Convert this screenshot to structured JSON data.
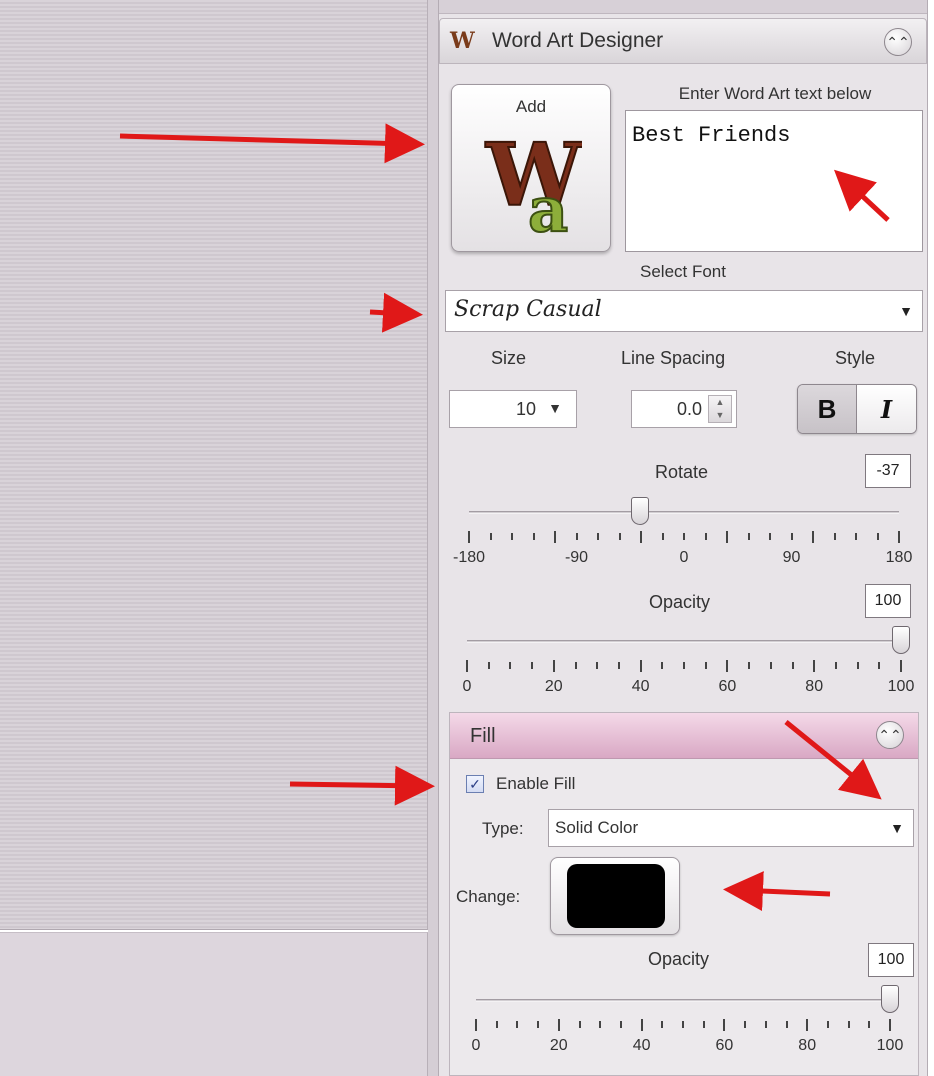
{
  "panel": {
    "title": "Word Art Designer",
    "logo_text": "W"
  },
  "add_button": {
    "label": "Add",
    "icon_letters": "Wa"
  },
  "text_entry": {
    "label": "Enter Word Art text below",
    "value": "Best Friends"
  },
  "font": {
    "label": "Select Font",
    "value": "Scrap Casual"
  },
  "size": {
    "label": "Size",
    "value": "10"
  },
  "line_spacing": {
    "label": "Line Spacing",
    "value": "0.0"
  },
  "style": {
    "label": "Style",
    "bold": "B",
    "italic": "I"
  },
  "rotate": {
    "label": "Rotate",
    "value": "-37",
    "min": -180,
    "max": 180,
    "level": -37,
    "tick_labels": [
      "-180",
      "-90",
      "0",
      "90",
      "180"
    ]
  },
  "opacity": {
    "label": "Opacity",
    "value": "100",
    "min": 0,
    "max": 100,
    "level": 100,
    "tick_labels": [
      "0",
      "20",
      "40",
      "60",
      "80",
      "100"
    ]
  },
  "fill": {
    "title": "Fill",
    "enable_label": "Enable Fill",
    "enabled": true,
    "type_label": "Type:",
    "type_value": "Solid Color",
    "change_label": "Change:",
    "color": "#000000",
    "opacity_label": "Opacity",
    "opacity_value": "100",
    "opacity_level": 100,
    "tick_labels": [
      "0",
      "20",
      "40",
      "60",
      "80",
      "100"
    ]
  },
  "colors": {
    "annotation_arrow": "#e01818",
    "fill_header": "#e3bcd3"
  }
}
